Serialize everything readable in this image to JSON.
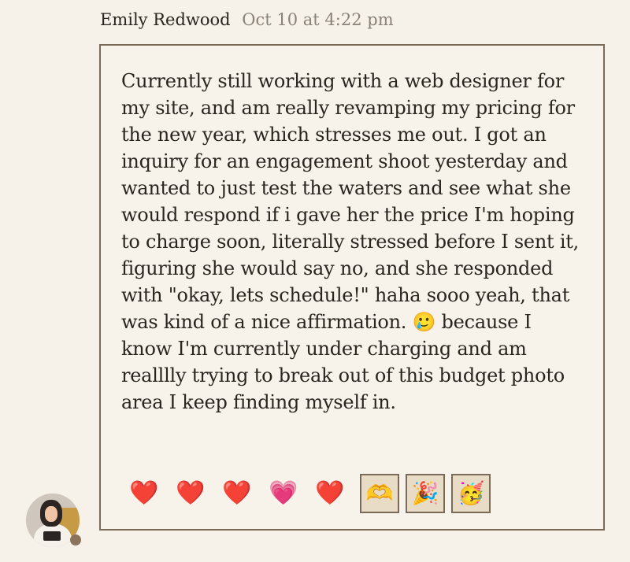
{
  "post": {
    "author": "Emily Redwood",
    "timestamp": "Oct 10 at 4:22 pm",
    "body": "Currently still working with a web designer for my site, and am really revamping my pricing for the new year, which stresses me out. I got an inquiry for an engagement shoot yesterday and wanted to just test the waters and see what she would respond if i gave her the price I'm hoping to charge soon, literally stressed before I sent it, figuring she would say no, and she responded with \"okay, lets schedule!\" haha sooo yeah, that was kind of a nice affirmation. 🥲 because I know I'm currently under charging and am realllly trying to break out of this budget photo area I keep finding myself in."
  },
  "reactions": [
    {
      "emoji": "❤️",
      "icon": "red-heart-icon",
      "selected": false
    },
    {
      "emoji": "❤️",
      "icon": "red-heart-icon",
      "selected": false
    },
    {
      "emoji": "❤️",
      "icon": "red-heart-icon",
      "selected": false
    },
    {
      "emoji": "💗",
      "icon": "pink-heart-icon",
      "selected": false
    },
    {
      "emoji": "❤️",
      "icon": "red-heart-icon",
      "selected": false
    },
    {
      "emoji": "🫶",
      "icon": "heart-hands-icon",
      "selected": true
    },
    {
      "emoji": "🎉",
      "icon": "party-popper-icon",
      "selected": true
    },
    {
      "emoji": "🥳",
      "icon": "partying-face-icon",
      "selected": true
    }
  ],
  "colors": {
    "background": "#f6f2e9",
    "border": "#7a6a58",
    "selected_reaction_bg": "#e8dcc7",
    "status_dot": "#8b735c"
  }
}
